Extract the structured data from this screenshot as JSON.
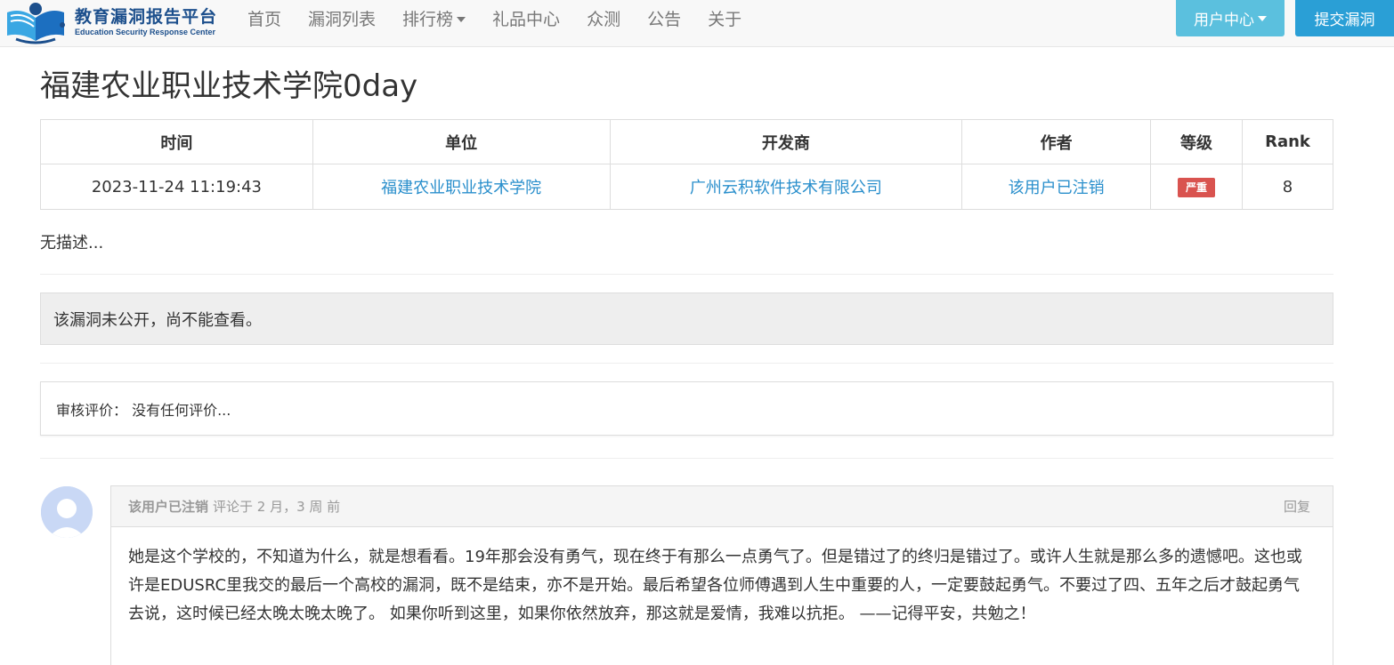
{
  "brand": {
    "name_cn": "教育漏洞报告平台",
    "name_en": "Education Security Response Center",
    "colors": {
      "primary": "#1c4f8c",
      "accent": "#2a9fd6",
      "info": "#5bc0de",
      "danger": "#d9534f"
    }
  },
  "nav": {
    "items": [
      {
        "label": "首页"
      },
      {
        "label": "漏洞列表"
      },
      {
        "label": "排行榜"
      },
      {
        "label": "礼品中心"
      },
      {
        "label": "众测"
      },
      {
        "label": "公告"
      },
      {
        "label": "关于"
      }
    ],
    "user_center": "用户中心",
    "submit": "提交漏洞"
  },
  "page": {
    "title": "福建农业职业技术学院0day"
  },
  "table": {
    "headers": [
      "时间",
      "单位",
      "开发商",
      "作者",
      "等级",
      "Rank"
    ],
    "row": {
      "time": "2023-11-24 11:19:43",
      "unit": "福建农业职业技术学院",
      "vendor": "广州云积软件技术有限公司",
      "author": "该用户已注销",
      "level": "严重",
      "rank": "8"
    }
  },
  "description": "无描述...",
  "notice": "该漏洞未公开，尚不能查看。",
  "review": "审核评价：  没有任何评价...",
  "comment": {
    "author": "该用户已注销",
    "meta": "评论于 2 月，3 周 前",
    "reply": "回复",
    "body": "她是这个学校的，不知道为什么，就是想看看。19年那会没有勇气，现在终于有那么一点勇气了。但是错过了的终归是错过了。或许人生就是那么多的遗憾吧。这也或许是EDUSRC里我交的最后一个高校的漏洞，既不是结束，亦不是开始。最后希望各位师傅遇到人生中重要的人，一定要鼓起勇气。不要过了四、五年之后才鼓起勇气去说，这时候已经太晚太晚太晚了。 如果你听到这里，如果你依然放弃，那这就是爱情，我难以抗拒。 ——记得平安，共勉之！"
  }
}
